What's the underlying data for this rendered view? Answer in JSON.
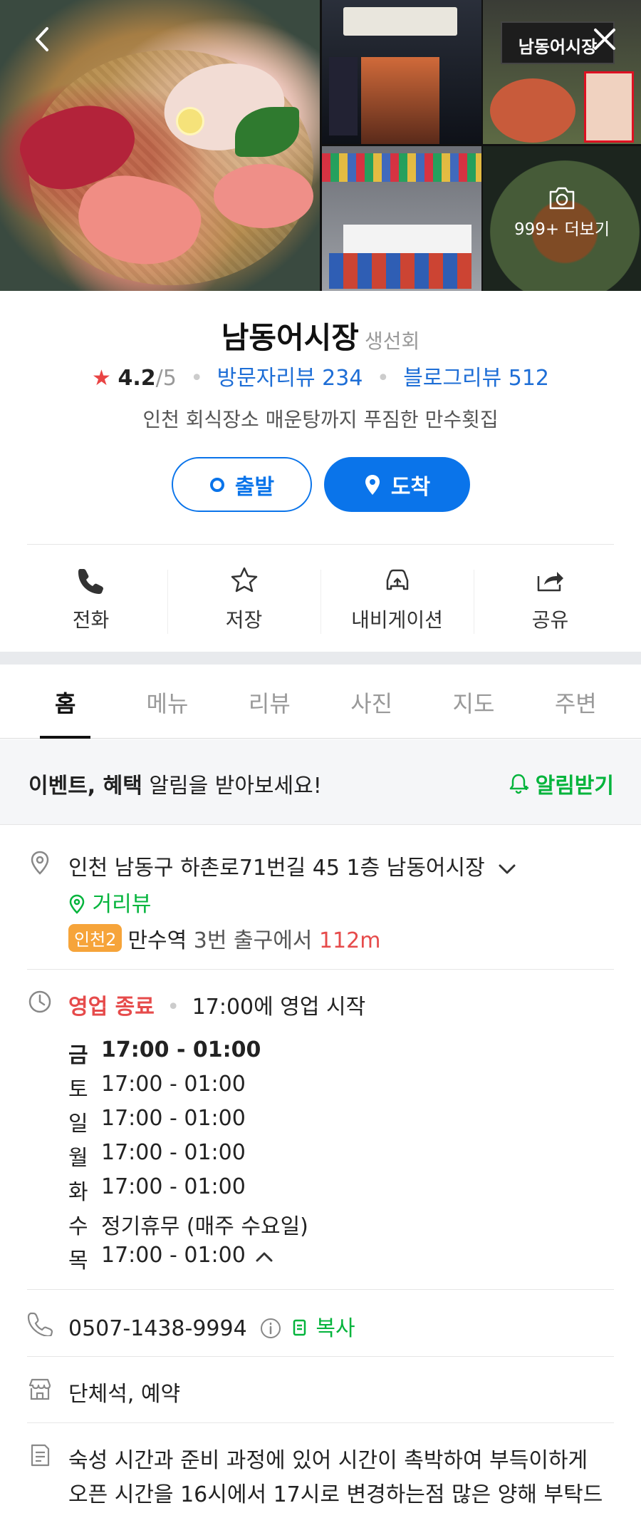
{
  "header": {
    "more_photos_label": "999+ 더보기",
    "sign_text": "남동어시장"
  },
  "place": {
    "name": "남동어시장",
    "category": "생선회",
    "rating": "4.2",
    "rating_outof": "/5",
    "visitor_review": "방문자리뷰 234",
    "blog_review": "블로그리뷰 512",
    "description": "인천 회식장소 매운탕까지 푸짐한 만수횟집"
  },
  "route": {
    "start_label": "출발",
    "arrive_label": "도착"
  },
  "actions": [
    {
      "label": "전화",
      "icon": "phone-icon"
    },
    {
      "label": "저장",
      "icon": "star-icon"
    },
    {
      "label": "내비게이션",
      "icon": "car-icon"
    },
    {
      "label": "공유",
      "icon": "share-icon"
    }
  ],
  "tabs": [
    "홈",
    "메뉴",
    "리뷰",
    "사진",
    "지도",
    "주변"
  ],
  "alert": {
    "bold": "이벤트, 혜택",
    "rest": " 알림을 받아보세요!",
    "button": "알림받기"
  },
  "address": {
    "text": "인천 남동구 하촌로71번길 45 1층 남동어시장",
    "street_view": "거리뷰",
    "subway_line": "인천2",
    "station": "만수역",
    "exit": " 3번 출구에서 ",
    "distance": "112m"
  },
  "hours": {
    "status": "영업 종료",
    "next_open": "17:00에 영업 시작",
    "days": [
      {
        "day": "금",
        "time": "17:00 - 01:00"
      },
      {
        "day": "토",
        "time": "17:00 - 01:00"
      },
      {
        "day": "일",
        "time": "17:00 - 01:00"
      },
      {
        "day": "월",
        "time": "17:00 - 01:00"
      },
      {
        "day": "화",
        "time": "17:00 - 01:00"
      },
      {
        "day": "수",
        "time": "정기휴무 (매주 수요일)"
      },
      {
        "day": "목",
        "time": "17:00 - 01:00"
      }
    ]
  },
  "phone": {
    "number": "0507-1438-9994",
    "copy_label": "복사"
  },
  "facilities": "단체석, 예약",
  "notice": {
    "line1": "숙성 시간과 준비 과정에 있어 시간이 촉박하여 부득이하게",
    "line2": "오픈 시간을 16시에서 17시로 변경하는점 많은 양해 부탁드"
  },
  "colors": {
    "brand_blue": "#0a74ea",
    "green": "#03b43c",
    "red": "#e64b4b"
  }
}
